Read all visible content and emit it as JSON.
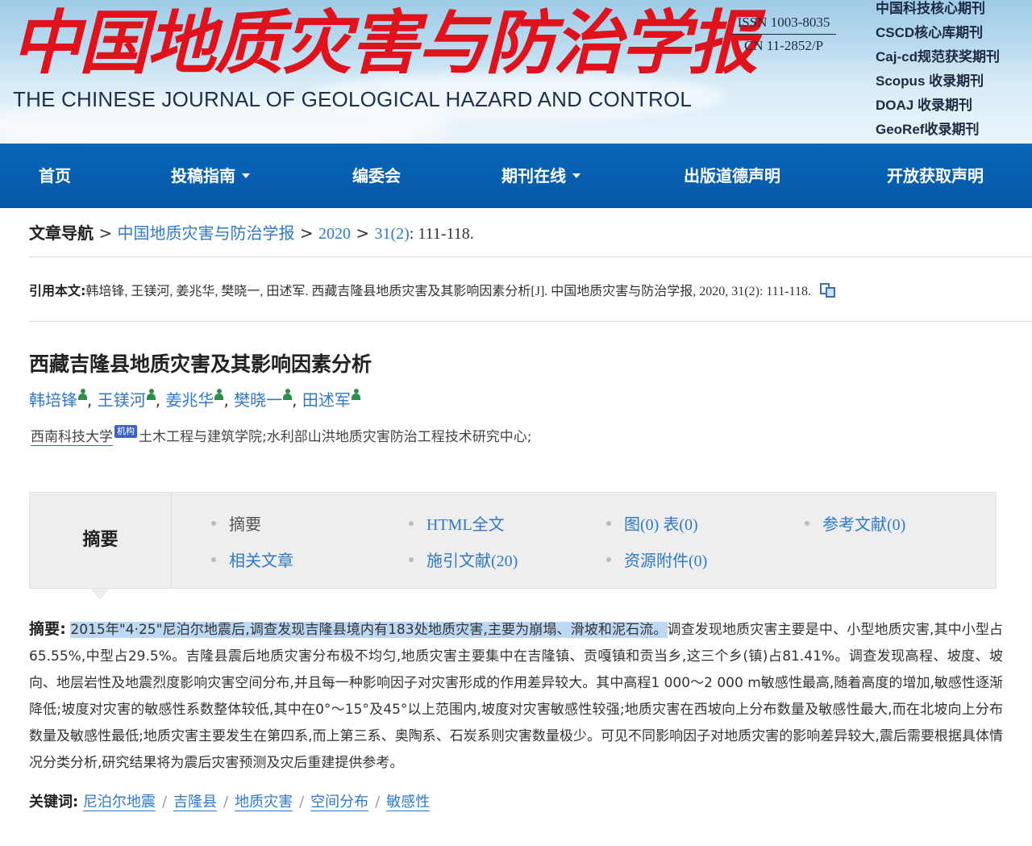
{
  "banner": {
    "logo_cn": "中国地质灾害与防治学报",
    "logo_en": "THE CHINESE JOURNAL OF GEOLOGICAL HAZARD AND CONTROL",
    "issn": "ISSN 1003-8035",
    "cn": "CN 11-2852/P",
    "badges": [
      "中国科技核心期刊",
      "CSCD核心库期刊",
      "Caj-cd规范获奖期刊",
      "Scopus 收录期刊",
      "DOAJ 收录期刊",
      "GeoRef收录期刊"
    ]
  },
  "nav": {
    "items": [
      {
        "label": "首页",
        "dropdown": false
      },
      {
        "label": "投稿指南",
        "dropdown": true
      },
      {
        "label": "编委会",
        "dropdown": false
      },
      {
        "label": "期刊在线",
        "dropdown": true
      },
      {
        "label": "出版道德声明",
        "dropdown": false
      },
      {
        "label": "开放获取声明",
        "dropdown": false
      }
    ]
  },
  "breadcrumb": {
    "label": "文章导航",
    "sep": ">",
    "journal": "中国地质灾害与防治学报",
    "year": "2020",
    "issue": "31(2)",
    "pages": ": 111-118."
  },
  "citation": {
    "label": "引用本文:",
    "text": "韩培锋, 王镁河, 姜兆华, 樊晓一, 田述军. 西藏吉隆县地质灾害及其影响因素分析[J]. 中国地质灾害与防治学报, 2020, 31(2): 111-118."
  },
  "article": {
    "title": "西藏吉隆县地质灾害及其影响因素分析",
    "authors": [
      "韩培锋",
      "王镁河",
      "姜兆华",
      "樊晓一",
      "田述军"
    ],
    "affiliation_org": "西南科技大学",
    "affiliation_badge": "机构",
    "affiliation_rest": "土木工程与建筑学院;水利部山洪地质灾害防治工程技术研究中心;"
  },
  "tabs": {
    "section_label": "摘要",
    "items": [
      "摘要",
      "HTML全文",
      "图(0) 表(0)",
      "参考文献(0)",
      "相关文章",
      "施引文献(20)",
      "资源附件(0)"
    ]
  },
  "abstract": {
    "label": "摘要:",
    "highlighted": "2015年\"4·25\"尼泊尔地震后,调查发现吉隆县境内有183处地质灾害,主要为崩塌、滑坡和泥石流。",
    "rest": "调查发现地质灾害主要是中、小型地质灾害,其中小型占65.55%,中型占29.5%。吉隆县震后地质灾害分布极不均匀,地质灾害主要集中在吉隆镇、贡嘎镇和贡当乡,这三个乡(镇)占81.41%。调查发现高程、坡度、坡向、地层岩性及地震烈度影响灾害空间分布,并且每一种影响因子对灾害形成的作用差异较大。其中高程1 000～2 000 m敏感性最高,随着高度的增加,敏感性逐渐降低;坡度对灾害的敏感性系数整体较低,其中在0°～15°及45°以上范围内,坡度对灾害敏感性较强;地质灾害在西坡向上分布数量及敏感性最大,而在北坡向上分布数量及敏感性最低;地质灾害主要发生在第四系,而上第三系、奥陶系、石炭系则灾害数量极少。可见不同影响因子对地质灾害的影响差异较大,震后需要根据具体情况分类分析,研究结果将为震后灾害预测及灾后重建提供参考。"
  },
  "keywords": {
    "label": "关键词:",
    "items": [
      "尼泊尔地震",
      "吉隆县",
      "地质灾害",
      "空间分布",
      "敏感性"
    ],
    "sep": "/"
  },
  "colors": {
    "accent": "#0a66b8",
    "link": "#2f79c8",
    "logo_red": "#e0121b",
    "highlight": "#bcd8f2"
  }
}
